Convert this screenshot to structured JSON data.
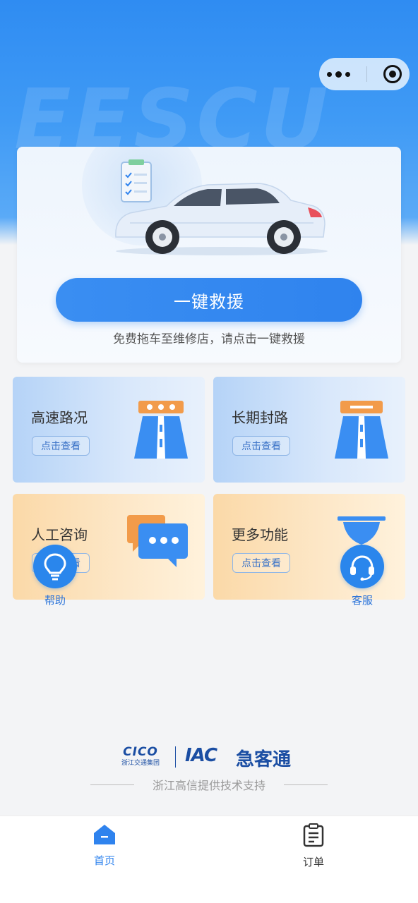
{
  "capsule": {
    "more_icon": "more-dots-icon",
    "close_icon": "target-circle-icon"
  },
  "hero": {
    "watermark": "EESCU"
  },
  "rescue": {
    "button_label": "一键救援",
    "hint": "免费拖车至维修店，请点击一键救援"
  },
  "tiles": [
    {
      "title": "高速路况",
      "action": "点击查看"
    },
    {
      "title": "长期封路",
      "action": "点击查看"
    },
    {
      "title": "人工咨询",
      "action": "点击查看"
    },
    {
      "title": "更多功能",
      "action": "点击查看"
    }
  ],
  "float": {
    "help": "帮助",
    "service": "客服"
  },
  "brand": {
    "cico": "CICO",
    "cico_sub": "浙江交通集团",
    "iac": "IAC",
    "name": "急客通"
  },
  "support": "浙江高信提供技术支持",
  "tabbar": {
    "home": "首页",
    "orders": "订单"
  },
  "colors": {
    "primary": "#2f83ee",
    "brand": "#1b4ea3",
    "tile_blue": "#c6ddf8",
    "tile_orange": "#fde2bb"
  }
}
